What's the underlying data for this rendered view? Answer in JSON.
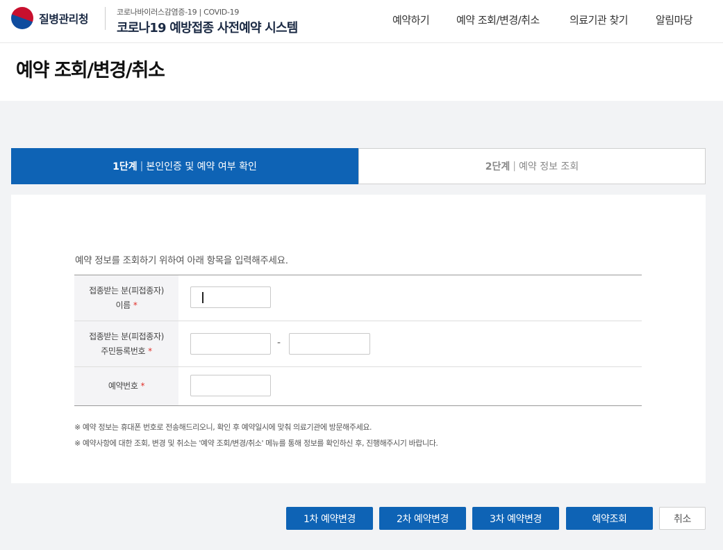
{
  "header": {
    "agency": "질병관리청",
    "system_subtitle": "코로나바이러스감염증-19 | COVID-19",
    "system_title": "코로나19 예방접종 사전예약 시스템",
    "nav": [
      "예약하기",
      "예약 조회/변경/취소",
      "의료기관 찾기",
      "알림마당"
    ]
  },
  "page": {
    "title": "예약 조회/변경/취소"
  },
  "steps": [
    {
      "num": "1단계",
      "sep": "|",
      "label": "본인인증 및 예약 여부 확인",
      "active": true
    },
    {
      "num": "2단계",
      "sep": "|",
      "label": "예약 정보 조회",
      "active": false
    }
  ],
  "form": {
    "intro": "예약 정보를 조회하기 위하여 아래 항목을 입력해주세요.",
    "required_mark": "*",
    "fields": {
      "name": {
        "label_line1": "접종받는 분(피접종자)",
        "label_line2": "이름",
        "value": ""
      },
      "rrn": {
        "label_line1": "접종받는 분(피접종자)",
        "label_line2": "주민등록번호",
        "front": "",
        "separator": "-",
        "back": ""
      },
      "reservation": {
        "label": "예약번호",
        "value": ""
      }
    },
    "notes": [
      "※ 예약 정보는 휴대폰 번호로 전송해드리오니, 확인 후 예약일시에 맞춰 의료기관에 방문해주세요.",
      "※ 예약사항에 대한 조회, 변경 및 취소는 '예약 조회/변경/취소' 메뉴를 통해 정보를 확인하신 후, 진행해주시기 바랍니다."
    ]
  },
  "buttons": {
    "change1": "1차 예약변경",
    "change2": "2차 예약변경",
    "change3": "3차 예약변경",
    "lookup": "예약조회",
    "cancel": "취소"
  },
  "colors": {
    "primary": "#0e63b5",
    "required": "#e0302a"
  }
}
